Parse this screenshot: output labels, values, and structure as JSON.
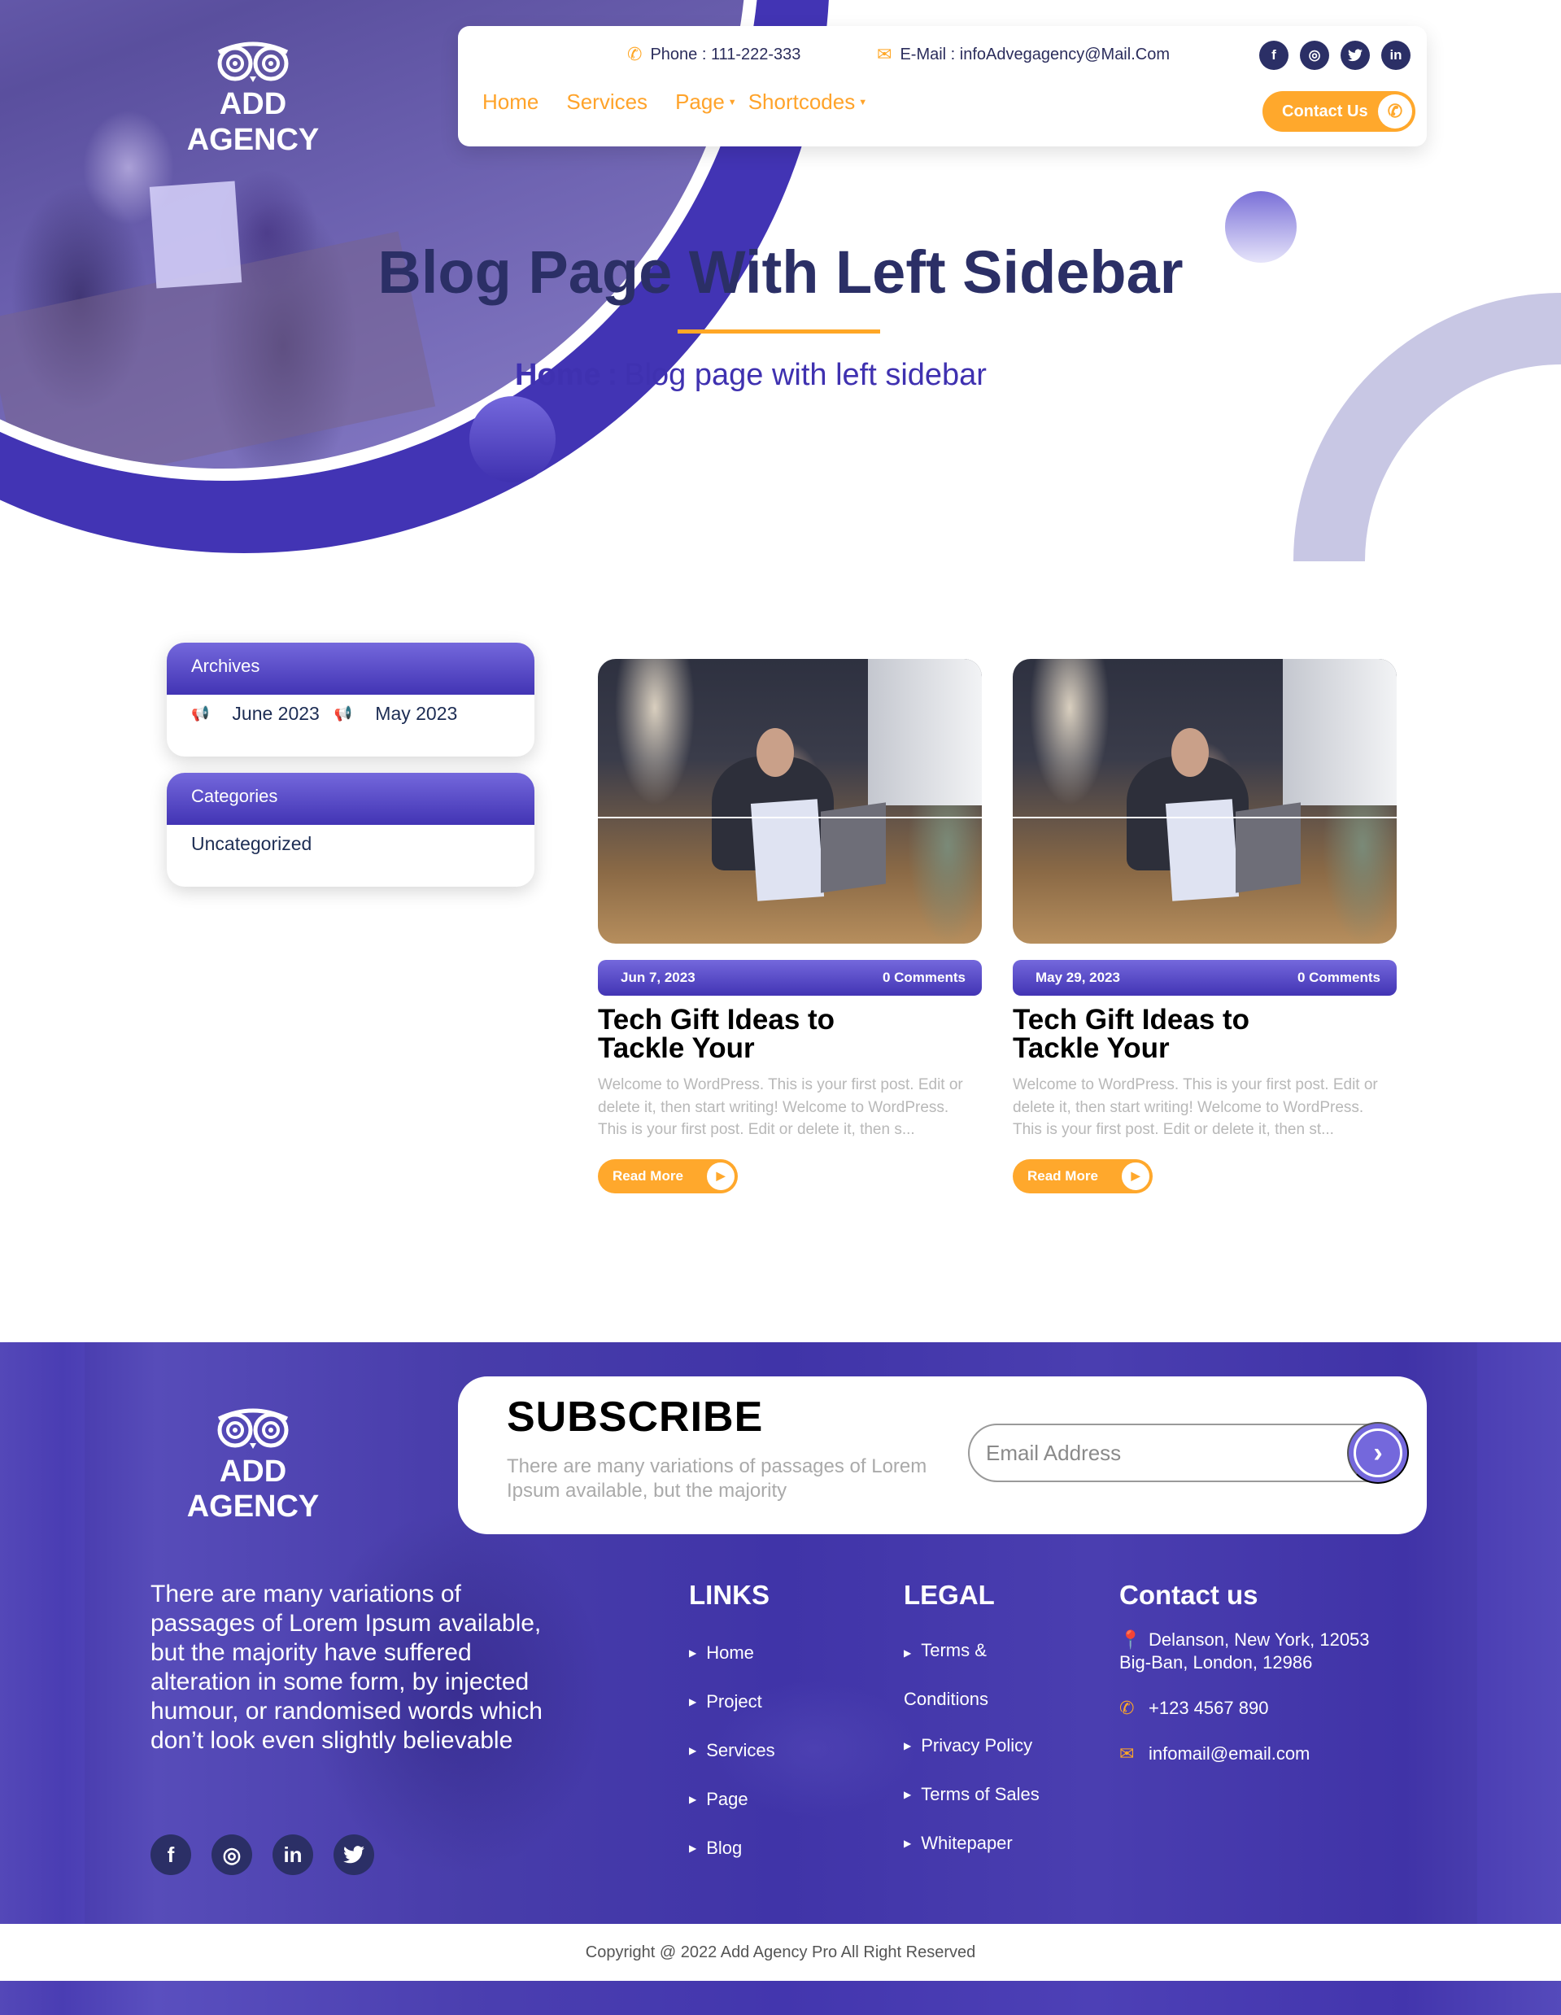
{
  "brand": {
    "name": "ADD AGENCY",
    "logo_icon": "owl-icon"
  },
  "header": {
    "phone_label": "Phone : 111-222-333",
    "email_label": "E-Mail : infoAdvegagency@Mail.Com",
    "social": [
      {
        "name": "facebook",
        "glyph": "f"
      },
      {
        "name": "instagram",
        "glyph": "◎"
      },
      {
        "name": "twitter",
        "glyph": "🐦"
      },
      {
        "name": "linkedin",
        "glyph": "in"
      }
    ],
    "nav": [
      {
        "label": "Home",
        "dropdown": false
      },
      {
        "label": "Services",
        "dropdown": false
      },
      {
        "label": "Page",
        "dropdown": true
      },
      {
        "label": "Shortcodes",
        "dropdown": true
      }
    ],
    "contact_button": "Contact Us"
  },
  "hero": {
    "title": "Blog Page With Left Sidebar",
    "breadcrumb": {
      "home": "Home",
      "separator": ":",
      "current": "Blog page with left sidebar"
    }
  },
  "sidebar": {
    "archives": {
      "title": "Archives",
      "items": [
        "June 2023",
        "May 2023"
      ]
    },
    "categories": {
      "title": "Categories",
      "items": [
        "Uncategorized"
      ]
    }
  },
  "posts": [
    {
      "date": "Jun 7, 2023",
      "comments": "0 Comments",
      "title": "Tech Gift Ideas to Tackle Your",
      "excerpt": "Welcome to WordPress. This is your first post. Edit or delete it, then start writing! Welcome to WordPress. This is your first post. Edit or delete it, then s...",
      "read_more": "Read More"
    },
    {
      "date": "May 29, 2023",
      "comments": "0 Comments",
      "title": "Tech Gift Ideas to Tackle Your",
      "excerpt": "Welcome to WordPress. This is your first post. Edit or delete it, then start writing! Welcome to WordPress. This is your first post. Edit or delete it, then st...",
      "read_more": "Read More"
    }
  ],
  "footer": {
    "subscribe": {
      "title": "SUBSCRIBE",
      "text": "There are many variations of passages of Lorem Ipsum available, but the majority",
      "email_placeholder": "Email Address",
      "email_value": ""
    },
    "about": "There are many variations of passages of Lorem Ipsum available, but the majority have suffered alteration in some form, by injected humour, or randomised words which don’t look even slightly believable",
    "social": [
      {
        "name": "facebook",
        "glyph": "f"
      },
      {
        "name": "instagram",
        "glyph": "◎"
      },
      {
        "name": "linkedin",
        "glyph": "in"
      },
      {
        "name": "twitter",
        "glyph": "🐦"
      }
    ],
    "links": {
      "title": "LINKS",
      "items": [
        "Home",
        "Project",
        "Services",
        "Page",
        "Blog"
      ]
    },
    "legal": {
      "title": "LEGAL",
      "items": [
        "Terms &",
        "Conditions",
        "Privacy Policy",
        "Terms of Sales",
        "Whitepaper"
      ]
    },
    "contact": {
      "title": "Contact us",
      "address_line1": "Delanson, New York, 12053",
      "address_line2": "Big-Ban, London, 12986",
      "phone": "+123 4567 890",
      "email": "infomail@email.com"
    },
    "copyright": "Copyright @ 2022 Add Agency Pro All Right Reserved"
  },
  "colors": {
    "primary": "#4234b4",
    "accent": "#ffa82c",
    "dark": "#2b2f66"
  }
}
